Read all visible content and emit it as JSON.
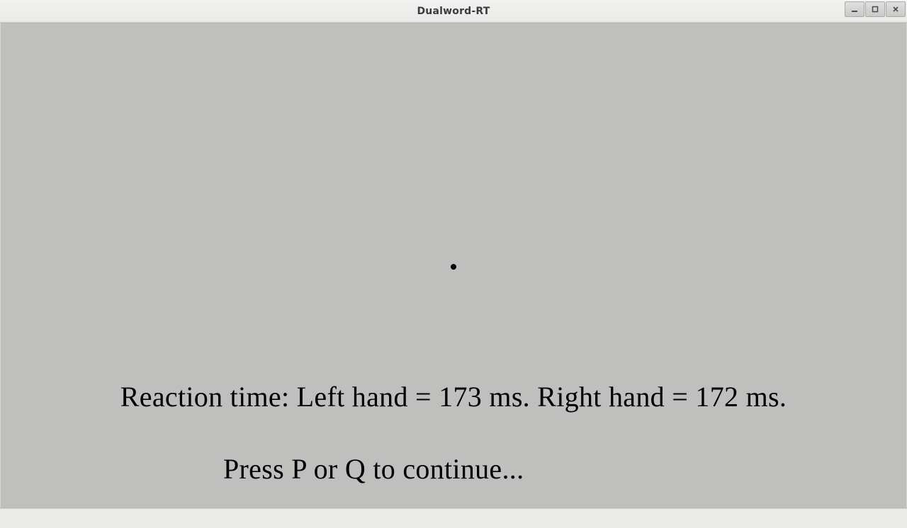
{
  "window": {
    "title": "Dualword-RT"
  },
  "stage": {
    "feedback_text": "Reaction time: Left hand = 173 ms. Right hand = 172 ms.",
    "prompt_text": "Press P or Q to continue..."
  }
}
